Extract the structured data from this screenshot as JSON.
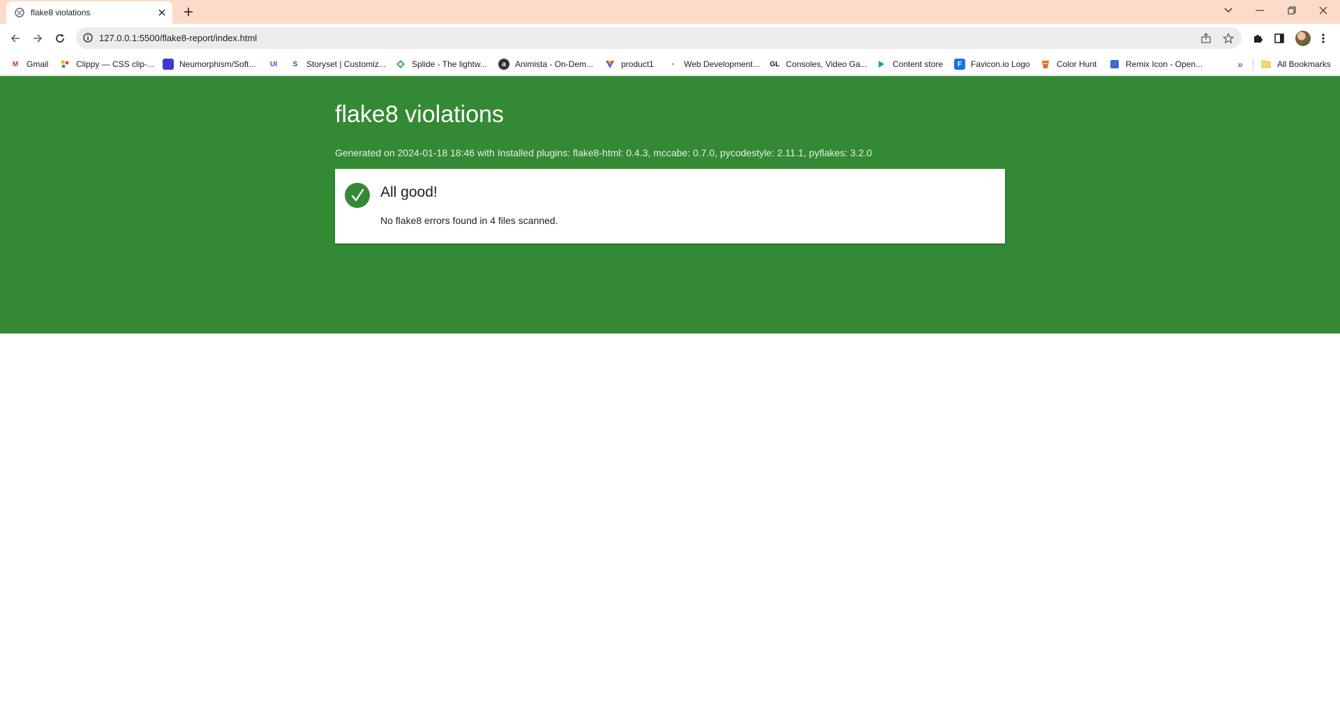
{
  "browser": {
    "tab": {
      "title": "flake8 violations"
    },
    "address": {
      "url": "127.0.0.1:5500/flake8-report/index.html"
    },
    "bookmarks": [
      {
        "label": "Gmail",
        "icon": "gmail-icon",
        "color": "#d93025"
      },
      {
        "label": "Clippy — CSS clip-...",
        "icon": "clippy-icon",
        "color": "#f4b400"
      },
      {
        "label": "Neumorphism/Soft...",
        "icon": "neumorphism-icon",
        "color": "#3b3bd1"
      },
      {
        "label": "",
        "icon": "ui-icon",
        "color": "#5a2ff0",
        "glyph": "UI"
      },
      {
        "label": "Storyset | Customiz...",
        "icon": "storyset-icon",
        "color": "#1e4d8c"
      },
      {
        "label": "Splide - The lightw...",
        "icon": "splide-icon",
        "color": "#3bb35a"
      },
      {
        "label": "Animista - On-Dem...",
        "icon": "animista-icon",
        "color": "#333333"
      },
      {
        "label": "product1",
        "icon": "product1-icon",
        "color": "#7a4fd6"
      },
      {
        "label": "Web Development...",
        "icon": "webdev-icon",
        "color": "#c8a000"
      },
      {
        "label": "Consoles, Video Ga...",
        "icon": "consoles-icon",
        "color": "#111111"
      },
      {
        "label": "Content store",
        "icon": "content-store-icon",
        "color": "#0aa1c8"
      },
      {
        "label": "Favicon.io Logo",
        "icon": "favicon-io-icon",
        "color": "#1a73e8"
      },
      {
        "label": "Color Hunt",
        "icon": "color-hunt-icon",
        "color": "#e06a3a"
      },
      {
        "label": "Remix Icon - Open...",
        "icon": "remix-icon",
        "color": "#1a73e8"
      }
    ],
    "all_bookmarks_label": "All Bookmarks"
  },
  "report": {
    "title": "flake8 violations",
    "subtitle": "Generated on 2024-01-18 18:46 with Installed plugins: flake8-html: 0.4.3, mccabe: 0.7.0, pycodestyle: 2.11.1, pyflakes: 3.2.0",
    "status_title": "All good!",
    "status_text": "No flake8 errors found in 4 files scanned."
  },
  "colors": {
    "hero_green": "#348a34",
    "tabstrip": "#fcdcc8"
  }
}
